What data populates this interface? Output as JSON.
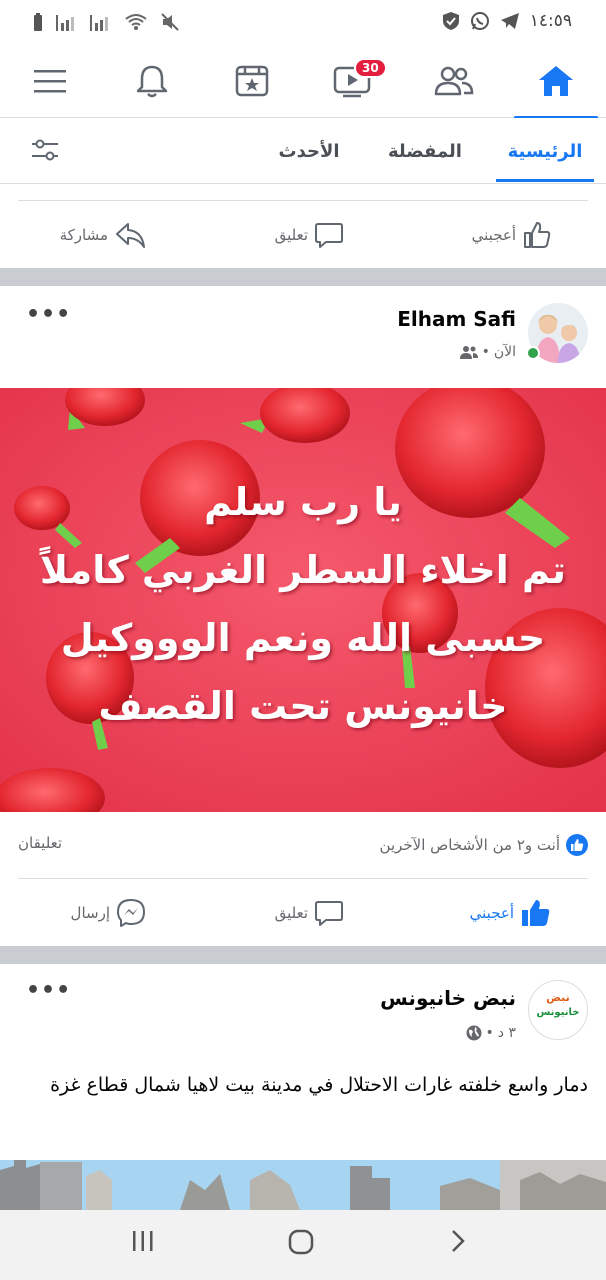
{
  "status_bar": {
    "time": "١٤:٥٩",
    "icons": [
      "battery-icon",
      "signal-icon",
      "signal-icon",
      "wifi-icon",
      "mute-icon",
      "shield-icon",
      "whatsapp-icon",
      "telegram-icon"
    ]
  },
  "nav": {
    "items": [
      "menu-icon",
      "bell-icon",
      "news-icon",
      "video-icon",
      "friends-icon",
      "home-icon"
    ],
    "video_badge": "30",
    "accent": "#1877f2",
    "badge_color": "#e41e3f"
  },
  "tabs": {
    "home": "الرئيسية",
    "favorites": "المفضلة",
    "recent": "الأحدث"
  },
  "actions": {
    "like": "أعجبني",
    "comment": "تعليق",
    "share": "مشاركة",
    "send": "إرسال"
  },
  "post1": {
    "author": "Elham Safi",
    "time": "الآن",
    "image_lines": [
      "يا رب سلم",
      "تم اخلاء السطر الغربي كاملاً",
      "حسبى الله ونعم الوووكيل",
      "خانيونس تحت القصف"
    ],
    "reactions_text": "أنت و٢ من الأشخاص الآخرين",
    "comments_text": "تعليقان"
  },
  "post2": {
    "author": "نبض خانيونس",
    "time": "٣ د",
    "text": "دمار واسع خلفته غارات الاحتلال في مدينة بيت لاهيا شمال قطاع غزة",
    "logo_text_top": "نبض",
    "logo_text_bottom": "خانيونس"
  }
}
